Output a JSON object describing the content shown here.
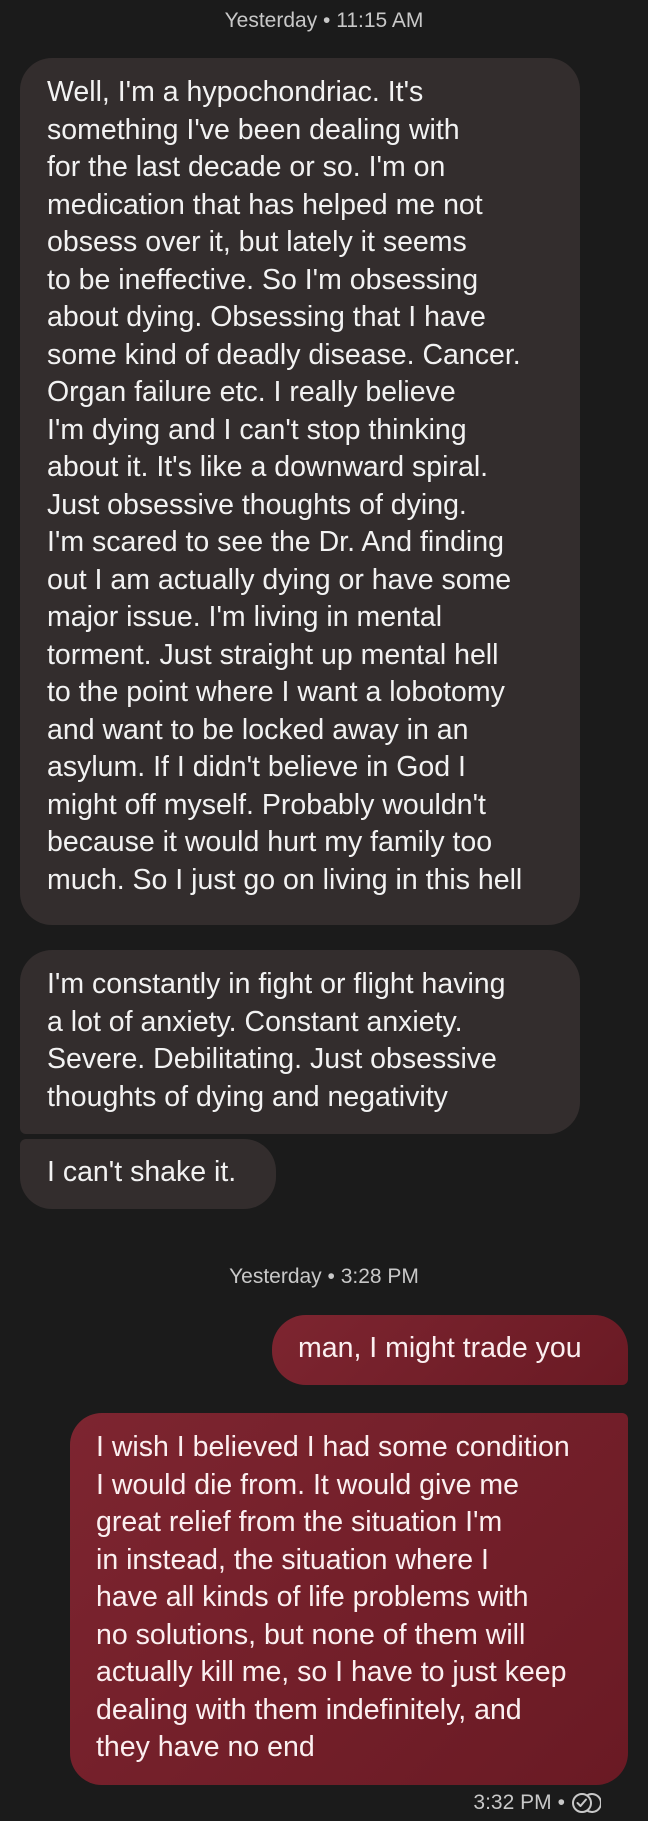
{
  "conversation": {
    "timestamp_1": "Yesterday • 11:15 AM",
    "timestamp_2": "Yesterday • 3:28 PM",
    "messages": [
      {
        "direction": "incoming",
        "text": "Well, I'm a hypochondriac. It's\nsomething I've been dealing with\nfor the last decade or so. I'm on\nmedication that has helped me not\nobsess over it, but lately it seems\nto be ineffective. So I'm obsessing\nabout dying. Obsessing that I have\nsome kind of deadly disease. Cancer.\nOrgan failure etc. I really believe\nI'm dying and I can't stop thinking\nabout it. It's like a downward spiral.\nJust obsessive thoughts of dying.\nI'm scared to see the Dr. And finding\nout I am actually dying or have some\nmajor issue. I'm living in mental\ntorment. Just straight up mental hell\nto the point where I want a lobotomy\nand want to be locked away in an\nasylum. If I didn't believe in God I\nmight off myself. Probably wouldn't\nbecause it would hurt my family too\nmuch. So I just go on living in this hell"
      },
      {
        "direction": "incoming",
        "text": "I'm constantly in fight or flight having\na lot of anxiety. Constant anxiety.\nSevere. Debilitating. Just obsessive\nthoughts of dying and negativity"
      },
      {
        "direction": "incoming",
        "text": "I can't shake it."
      },
      {
        "direction": "outgoing",
        "text": "man, I might trade you"
      },
      {
        "direction": "outgoing",
        "text": "I wish I believed I had some condition\nI would die from. It would give me\ngreat relief from the situation I'm\nin instead, the situation where I\nhave all kinds of life problems with\nno solutions, but none of them will\nactually kill me, so I have to just keep\ndealing with them indefinitely, and\nthey have no end"
      }
    ],
    "last_sent_time": "3:32 PM",
    "separator": "•",
    "status_icon": "read-receipt-icon"
  },
  "colors": {
    "background": "#1b1b1b",
    "incoming_bubble": "#332d2d",
    "outgoing_bubble": "#7d2530",
    "meta_text": "#c8c8c8"
  }
}
